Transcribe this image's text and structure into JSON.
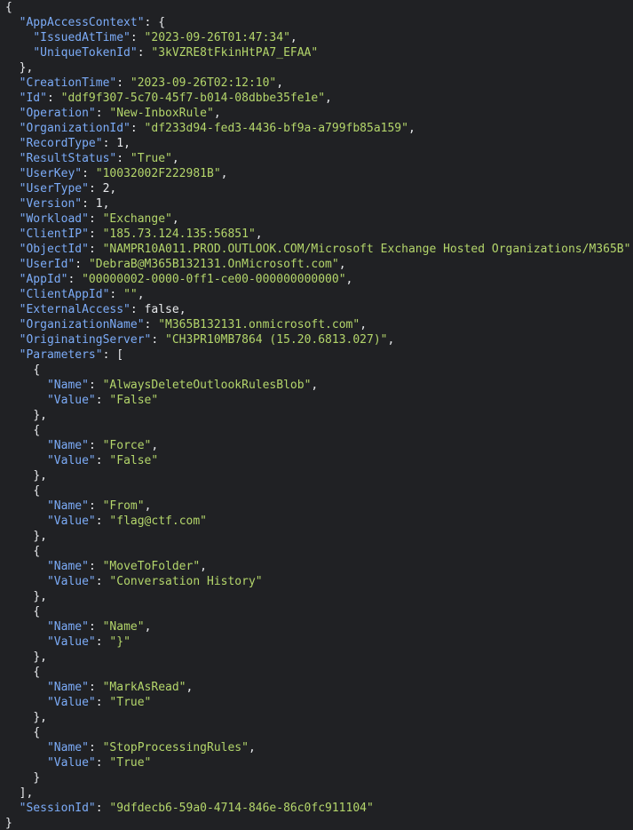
{
  "colors": {
    "background": "#202124",
    "key": "#7cacf8",
    "string": "#b4d66b",
    "punctuation": "#e8eaed"
  },
  "json": {
    "AppAccessContext": {
      "IssuedAtTime": "2023-09-26T01:47:34",
      "UniqueTokenId": "3kVZRE8tFkinHtPA7_EFAA"
    },
    "CreationTime": "2023-09-26T02:12:10",
    "Id": "ddf9f307-5c70-45f7-b014-08dbbe35fe1e",
    "Operation": "New-InboxRule",
    "OrganizationId": "df233d94-fed3-4436-bf9a-a799fb85a159",
    "RecordType": 1,
    "ResultStatus": "True",
    "UserKey": "10032002F222981B",
    "UserType": 2,
    "Version": 1,
    "Workload": "Exchange",
    "ClientIP": "185.73.124.135:56851",
    "ObjectId": "NAMPR10A011.PROD.OUTLOOK.COM/Microsoft Exchange Hosted Organizations/M365B",
    "UserId": "DebraB@M365B132131.OnMicrosoft.com",
    "AppId": "00000002-0000-0ff1-ce00-000000000000",
    "ClientAppId": "",
    "ExternalAccess": false,
    "OrganizationName": "M365B132131.onmicrosoft.com",
    "OriginatingServer": "CH3PR10MB7864 (15.20.6813.027)",
    "Parameters": [
      {
        "Name": "AlwaysDeleteOutlookRulesBlob",
        "Value": "False"
      },
      {
        "Name": "Force",
        "Value": "False"
      },
      {
        "Name": "From",
        "Value": "flag@ctf.com"
      },
      {
        "Name": "MoveToFolder",
        "Value": "Conversation History"
      },
      {
        "Name": "Name",
        "Value": "}"
      },
      {
        "Name": "MarkAsRead",
        "Value": "True"
      },
      {
        "Name": "StopProcessingRules",
        "Value": "True"
      }
    ],
    "SessionId": "9dfdecb6-59a0-4714-846e-86c0fc911104"
  }
}
